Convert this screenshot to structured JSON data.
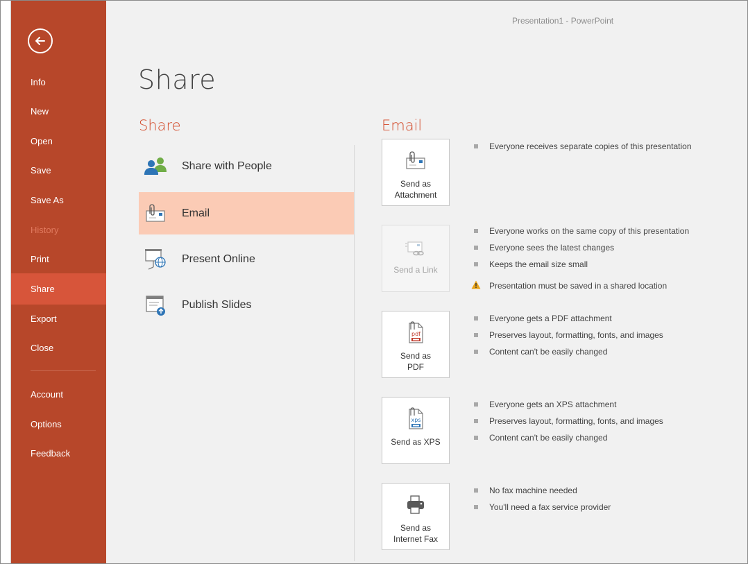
{
  "window_title": "Presentation1 - PowerPoint",
  "page_title": "Share",
  "sidebar": {
    "back_icon": "back-arrow-icon",
    "items": [
      {
        "label": "Info",
        "state": "normal"
      },
      {
        "label": "New",
        "state": "normal"
      },
      {
        "label": "Open",
        "state": "normal"
      },
      {
        "label": "Save",
        "state": "normal"
      },
      {
        "label": "Save As",
        "state": "normal"
      },
      {
        "label": "History",
        "state": "disabled"
      },
      {
        "label": "Print",
        "state": "normal"
      },
      {
        "label": "Share",
        "state": "active"
      },
      {
        "label": "Export",
        "state": "normal"
      },
      {
        "label": "Close",
        "state": "normal"
      },
      {
        "label": "Account",
        "state": "normal"
      },
      {
        "label": "Options",
        "state": "normal"
      },
      {
        "label": "Feedback",
        "state": "normal"
      }
    ]
  },
  "share_section": {
    "heading": "Share",
    "options": [
      {
        "label": "Share with People",
        "icon": "people-icon",
        "selected": false
      },
      {
        "label": "Email",
        "icon": "email-attachment-icon",
        "selected": true
      },
      {
        "label": "Present Online",
        "icon": "present-online-icon",
        "selected": false
      },
      {
        "label": "Publish Slides",
        "icon": "publish-slides-icon",
        "selected": false
      }
    ]
  },
  "email_section": {
    "heading": "Email",
    "actions": [
      {
        "label": "Send as\nAttachment",
        "icon": "attachment-envelope-icon",
        "enabled": true,
        "bullets": [
          "Everyone receives separate copies of this presentation"
        ],
        "warning": ""
      },
      {
        "label": "Send a Link",
        "icon": "link-envelope-icon",
        "enabled": false,
        "bullets": [
          "Everyone works on the same copy of this presentation",
          "Everyone sees the latest changes",
          "Keeps the email size small"
        ],
        "warning": "Presentation must be saved in a shared location"
      },
      {
        "label": "Send as\nPDF",
        "icon": "pdf-icon",
        "enabled": true,
        "bullets": [
          "Everyone gets a PDF attachment",
          "Preserves layout, formatting, fonts, and images",
          "Content can't be easily changed"
        ],
        "warning": ""
      },
      {
        "label": "Send as XPS",
        "icon": "xps-icon",
        "enabled": true,
        "bullets": [
          "Everyone gets an XPS attachment",
          "Preserves layout, formatting, fonts, and images",
          "Content can't be easily changed"
        ],
        "warning": ""
      },
      {
        "label": "Send as\nInternet Fax",
        "icon": "fax-icon",
        "enabled": true,
        "bullets": [
          "No fax machine needed",
          "You'll need a fax service provider"
        ],
        "warning": ""
      }
    ]
  },
  "colors": {
    "sidebar_bg": "#b7472a",
    "sidebar_active": "#d7553a",
    "accent_heading": "#d24726",
    "selected_option": "#fbcbb5",
    "warning": "#e8a317"
  }
}
